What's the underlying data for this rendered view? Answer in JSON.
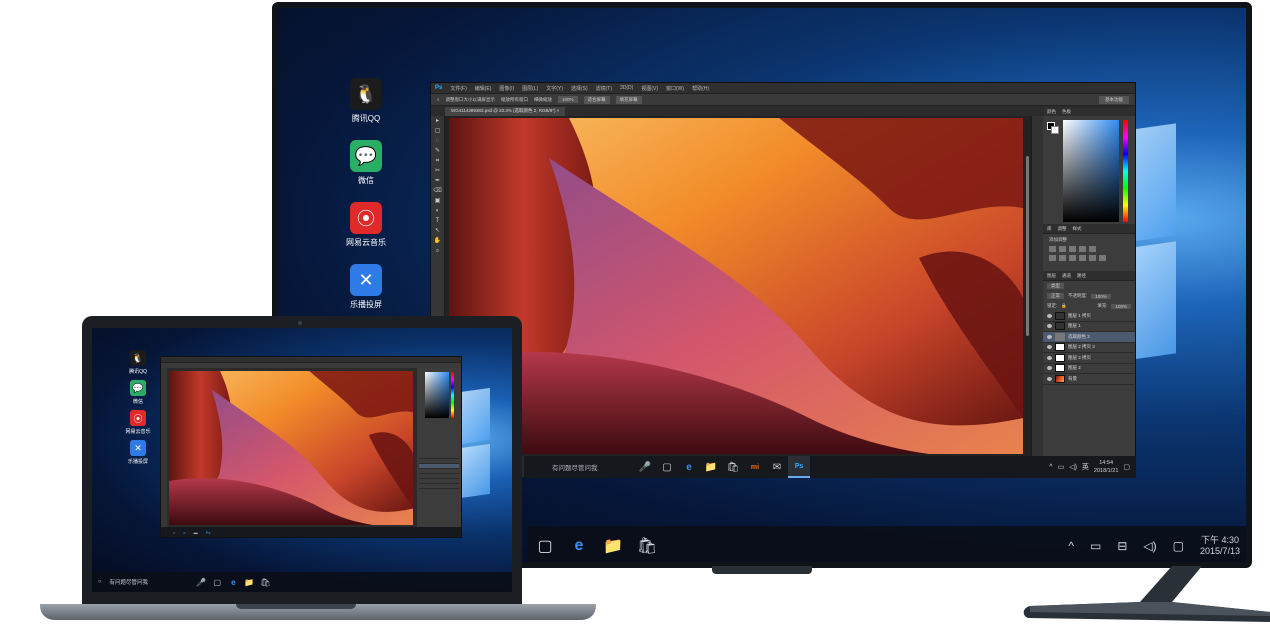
{
  "desktop": {
    "icons": [
      {
        "label": "腾讯QQ",
        "icon": "qq-penguin-icon",
        "bg": "#1b1b1b",
        "glyph": "🐧"
      },
      {
        "label": "微信",
        "icon": "wechat-icon",
        "bg": "#2aae67",
        "glyph": "💬"
      },
      {
        "label": "网易云音乐",
        "icon": "netease-music-icon",
        "bg": "#e02a2a",
        "glyph": "⦿"
      },
      {
        "label": "乐播投屏",
        "icon": "lebo-cast-icon",
        "bg": "#2e7ae6",
        "glyph": "✕"
      }
    ]
  },
  "photoshop": {
    "logo": "Ps",
    "menu": [
      "文件(F)",
      "编辑(E)",
      "图像(I)",
      "图层(L)",
      "文字(Y)",
      "选择(S)",
      "滤镜(T)",
      "3D(D)",
      "视图(V)",
      "窗口(W)",
      "帮助(H)"
    ],
    "options": {
      "resize": "调整窗口大小以满屏显示",
      "zoom_all": "缩放所有窗口",
      "scrubby": "细微缩放",
      "pct": "100%",
      "fit": "适合屏幕",
      "fill": "填充屏幕",
      "workspace": "基本功能"
    },
    "doc_tab": "WG4114389383.psd @ 33.3% (选取颜色 2, RGB/8*) ×",
    "tools": [
      "▸",
      "▢",
      "◌",
      "✎",
      "⌗",
      "✂",
      "✒",
      "⌫",
      "▣",
      "◐",
      "T",
      "↖",
      "✋",
      "⌕"
    ],
    "panels": {
      "color_tabs": [
        "颜色",
        "色板"
      ],
      "adjust_tabs": [
        "库",
        "调整",
        "样式"
      ],
      "adjust_title": "添加调整",
      "layer_tabs": [
        "图层",
        "通道",
        "路径"
      ],
      "kind": "类型",
      "blend": "正常",
      "opacity_label": "不透明度:",
      "opacity": "100%",
      "lock_label": "锁定:",
      "fill_label": "填充:",
      "fill": "100%",
      "layers": [
        {
          "name": "图层 1 拷贝",
          "thumb": "dark",
          "selected": false
        },
        {
          "name": "图层 1",
          "thumb": "dark",
          "selected": false
        },
        {
          "name": "选取颜色 2",
          "thumb": "",
          "selected": true
        },
        {
          "name": "图层 2 拷贝 3",
          "thumb": "white",
          "selected": false
        },
        {
          "name": "图层 2 拷贝",
          "thumb": "white",
          "selected": false
        },
        {
          "name": "图层 2",
          "thumb": "white",
          "selected": false
        },
        {
          "name": "背景",
          "thumb": "img",
          "selected": false
        }
      ]
    }
  },
  "taskbar_small": {
    "search": "有问题尽管问我",
    "apps": [
      "▢",
      "e",
      "📁",
      "🛍",
      "mi",
      "✉",
      "Ps"
    ],
    "tray": [
      "^",
      "▭",
      "◁)",
      "英",
      "▢"
    ],
    "time": "14:54",
    "date": "2018/1/21"
  },
  "taskbar_big": {
    "apps": [
      "▢",
      "e",
      "📁",
      "🛍"
    ],
    "tray": [
      "^",
      "▭",
      "⊟",
      "◁)",
      "▢"
    ],
    "time": "下午 4:30",
    "date": "2015/7/13"
  },
  "laptop": {
    "icons": [
      "腾讯QQ",
      "微信",
      "网易云音乐",
      "乐播投屏"
    ],
    "search": "有问题尽管问我"
  },
  "colors": {
    "accent": "#31a8ff",
    "desktop_blue": "#1d64b8"
  }
}
